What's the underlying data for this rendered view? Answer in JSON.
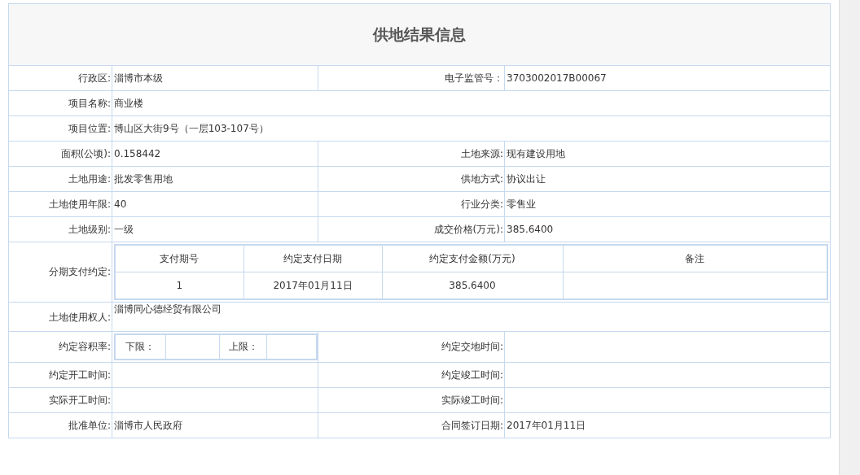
{
  "title": "供地结果信息",
  "rows": [
    {
      "kind": "pair",
      "label": "行政区:",
      "value": "淄博市本级",
      "label2": "电子监管号：",
      "value2": "3703002017B00067"
    },
    {
      "kind": "single",
      "label": "项目名称:",
      "value": "商业楼"
    },
    {
      "kind": "single",
      "label": "项目位置:",
      "value": "博山区大街9号（一层103-107号）"
    },
    {
      "kind": "pair",
      "label": "面积(公顷):",
      "value": "0.158442",
      "label2": "土地来源:",
      "value2": "现有建设用地"
    },
    {
      "kind": "pair",
      "label": "土地用途:",
      "value": "批发零售用地",
      "label2": "供地方式:",
      "value2": "协议出让"
    },
    {
      "kind": "pair",
      "label": "土地使用年限:",
      "value": "40",
      "label2": "行业分类:",
      "value2": "零售业"
    },
    {
      "kind": "pair",
      "label": "土地级别:",
      "value": "一级",
      "label2": "成交价格(万元):",
      "value2": "385.6400"
    },
    {
      "kind": "installments",
      "label": "分期支付约定:",
      "columns": [
        "支付期号",
        "约定支付日期",
        "约定支付金额(万元)",
        "备注"
      ],
      "entries": [
        [
          "1",
          "2017年01月11日",
          "385.6400"
        ]
      ]
    },
    {
      "kind": "owner",
      "label": "土地使用权人:",
      "value": "淄博同心德经贸有限公司"
    },
    {
      "kind": "ratio",
      "label": "约定容积率:",
      "lower_label": "下限：",
      "upper_label": "上限：",
      "label2": "约定交地时间:"
    },
    {
      "kind": "pair",
      "label": "约定开工时间:",
      "label2": "约定竣工时间:"
    },
    {
      "kind": "pair",
      "label": "实际开工时间:",
      "label2": "实际竣工时间:"
    },
    {
      "kind": "pair",
      "label": "批准单位:",
      "value": "淄博市人民政府",
      "label2": "合同签订日期:",
      "value2": "2017年01月11日"
    }
  ]
}
